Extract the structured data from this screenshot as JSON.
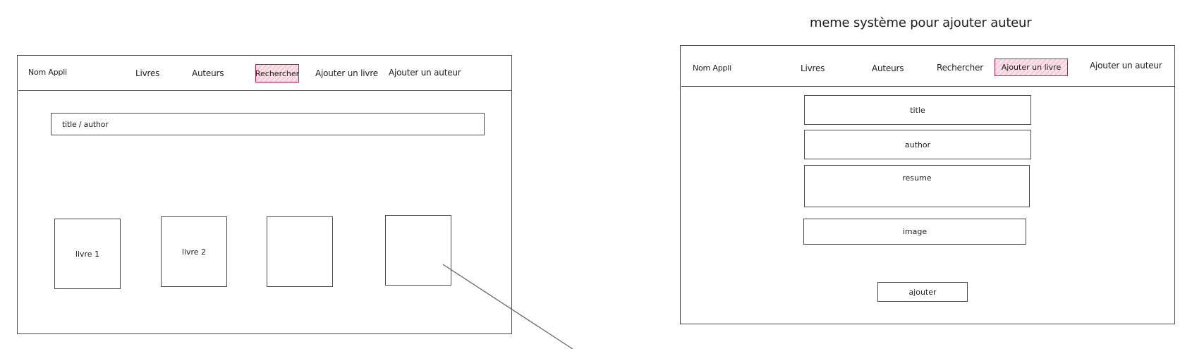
{
  "heading": "meme système pour ajouter auteur",
  "left_screen": {
    "app_name": "Nom Appli",
    "nav": [
      {
        "label": "Livres"
      },
      {
        "label": "Auteurs"
      },
      {
        "label": "Rechercher",
        "active": true
      },
      {
        "label": "Ajouter un livre"
      },
      {
        "label": "Ajouter un auteur"
      }
    ],
    "search_placeholder": "title / author",
    "cards": [
      {
        "label": "livre 1"
      },
      {
        "label": "livre 2"
      },
      {
        "label": ""
      },
      {
        "label": ""
      }
    ]
  },
  "right_screen": {
    "app_name": "Nom Appli",
    "nav": [
      {
        "label": "Livres"
      },
      {
        "label": "Auteurs"
      },
      {
        "label": "Rechercher"
      },
      {
        "label": "Ajouter un livre",
        "active": true
      },
      {
        "label": "Ajouter un auteur"
      }
    ],
    "fields": {
      "title": "title",
      "author": "author",
      "resume": "resume",
      "image": "image"
    },
    "submit_label": "ajouter"
  },
  "colors": {
    "highlight_border": "#c2185b",
    "highlight_fill": "#f6c9d6"
  }
}
